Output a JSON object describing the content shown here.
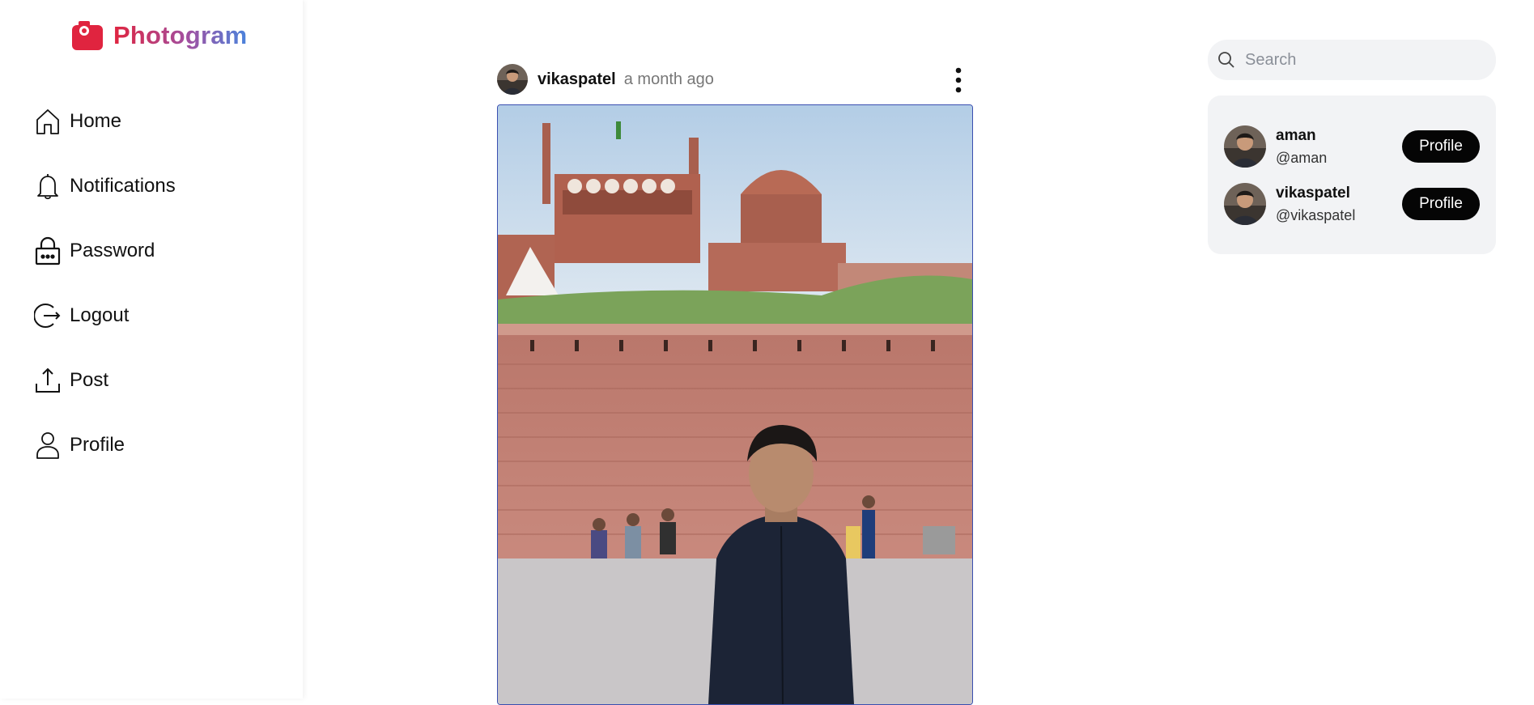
{
  "brand": {
    "name": "Photogram",
    "icon": "camera-icon",
    "color": "#e0243f"
  },
  "sidebar": {
    "items": [
      {
        "label": "Home",
        "icon": "home-icon"
      },
      {
        "label": "Notifications",
        "icon": "bell-icon"
      },
      {
        "label": "Password",
        "icon": "lock-icon"
      },
      {
        "label": "Logout",
        "icon": "logout-icon"
      },
      {
        "label": "Post",
        "icon": "upload-icon"
      },
      {
        "label": "Profile",
        "icon": "user-icon"
      }
    ]
  },
  "post": {
    "username": "vikaspatel",
    "time": "a month ago",
    "menu_icon": "more-vertical-icon"
  },
  "search": {
    "placeholder": "Search",
    "value": ""
  },
  "suggestions": [
    {
      "name": "aman",
      "handle": "@aman",
      "button": "Profile"
    },
    {
      "name": "vikaspatel",
      "handle": "@vikaspatel",
      "button": "Profile"
    }
  ],
  "colors": {
    "accent": "#e0243f",
    "button": "#050505",
    "panel": "#f2f3f5"
  }
}
